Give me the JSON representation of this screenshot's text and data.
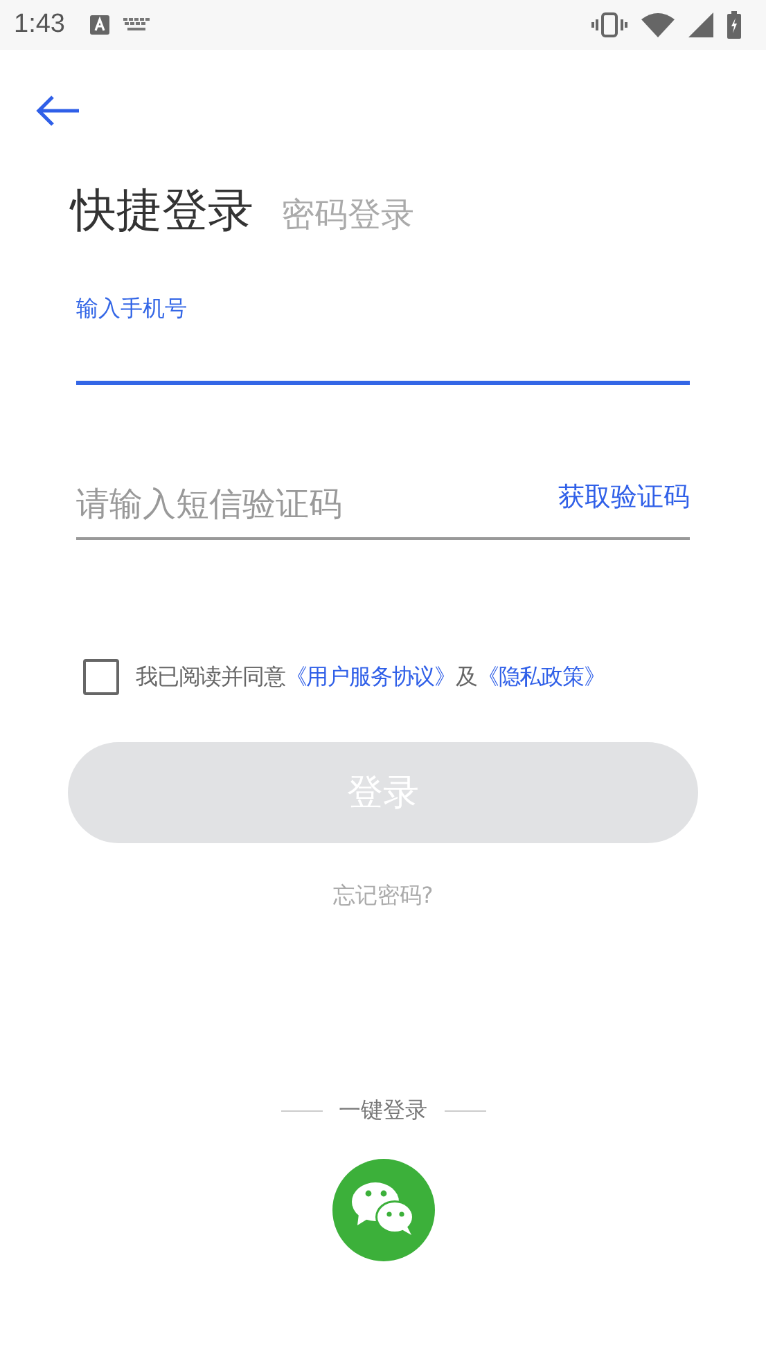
{
  "status_bar": {
    "time": "1:43"
  },
  "tabs": [
    {
      "label": "快捷登录",
      "selected": true
    },
    {
      "label": "密码登录",
      "selected": false
    }
  ],
  "phone_field": {
    "label": "输入手机号",
    "focused": true
  },
  "code_field": {
    "placeholder": "请输入短信验证码",
    "action": "获取验证码"
  },
  "agreement": {
    "checked": false,
    "text": "我已阅读并同意",
    "links": [
      "《用户服务协议》",
      "《隐私政策》"
    ],
    "joiner": "及"
  },
  "login_button": {
    "label": "登录",
    "disabled": true
  },
  "forgot_password": "忘记密码?",
  "quick_login": {
    "title": "一键登录"
  }
}
